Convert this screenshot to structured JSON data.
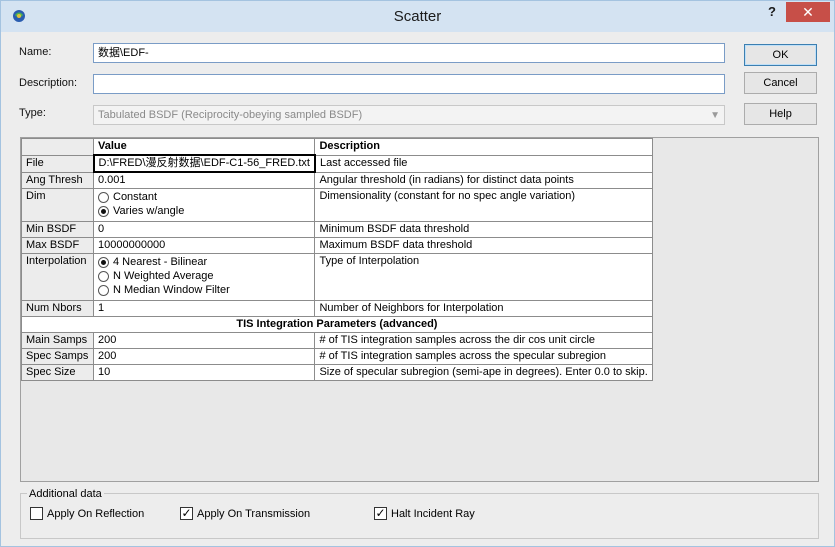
{
  "window": {
    "title": "Scatter",
    "help_glyph": "?",
    "close_glyph": "✕"
  },
  "form": {
    "name_label": "Name:",
    "name_value": "数据\\EDF-",
    "description_label": "Description:",
    "description_value": "",
    "type_label": "Type:",
    "type_value": "Tabulated BSDF (Reciprocity-obeying sampled BSDF)"
  },
  "buttons": {
    "ok": "OK",
    "cancel": "Cancel",
    "help": "Help"
  },
  "grid": {
    "headers": {
      "value": "Value",
      "description": "Description"
    },
    "rows": {
      "file": {
        "name": "File",
        "value": "D:\\FRED\\漫反射数据\\EDF-C1-56_FRED.txt",
        "desc": "Last accessed file"
      },
      "ang": {
        "name": "Ang Thresh",
        "value": "0.001",
        "desc": "Angular threshold (in radians) for distinct data points"
      },
      "dim": {
        "name": "Dim",
        "opt1": "Constant",
        "opt2": "Varies w/angle",
        "desc": "Dimensionality (constant for no spec angle variation)"
      },
      "minb": {
        "name": "Min BSDF",
        "value": "0",
        "desc": "Minimum BSDF data threshold"
      },
      "maxb": {
        "name": "Max BSDF",
        "value": "10000000000",
        "desc": "Maximum BSDF data threshold"
      },
      "interp": {
        "name": "Interpolation",
        "opt1": "4 Nearest - Bilinear",
        "opt2": "N Weighted Average",
        "opt3": "N Median Window Filter",
        "desc": "Type of Interpolation"
      },
      "nnbors": {
        "name": "Num Nbors",
        "value": "1",
        "desc": "Number of Neighbors for Interpolation"
      },
      "section": "TIS Integration Parameters (advanced)",
      "mainsamps": {
        "name": "Main Samps",
        "value": "200",
        "desc": "# of TIS integration samples across the dir cos unit circle"
      },
      "specsamps": {
        "name": "Spec Samps",
        "value": "200",
        "desc": "# of TIS integration samples across the specular subregion"
      },
      "specsize": {
        "name": "Spec Size",
        "value": "10",
        "desc": "Size of specular subregion (semi-ape in degrees).  Enter 0.0 to skip."
      }
    }
  },
  "additional": {
    "title": "Additional data",
    "reflection": {
      "label": "Apply On Reflection",
      "checked": false
    },
    "transmission": {
      "label": "Apply On Transmission",
      "checked": true
    },
    "halt": {
      "label": "Halt Incident Ray",
      "checked": true
    }
  }
}
